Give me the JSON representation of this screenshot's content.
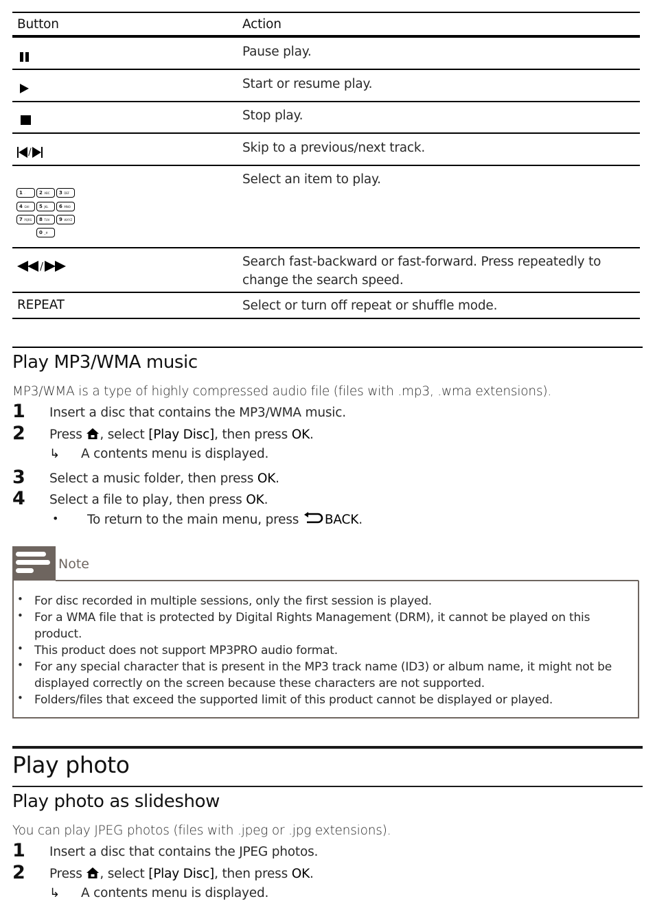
{
  "table": {
    "headers": {
      "button": "Button",
      "action": "Action"
    },
    "rows": [
      {
        "button_icon": "pause-icon",
        "button_text": "",
        "action": "Pause play."
      },
      {
        "button_icon": "play-icon",
        "button_text": "",
        "action": "Start or resume play."
      },
      {
        "button_icon": "stop-icon",
        "button_text": "",
        "action": "Stop play."
      },
      {
        "button_icon": "previous-next-icon",
        "button_text": "",
        "action": "Skip to a previous/next track."
      },
      {
        "button_icon": "numeric-keypad-icon",
        "button_text": "",
        "action": "Select an item to play."
      },
      {
        "button_icon": "fast-backward-forward-icon",
        "button_text": "",
        "action_line1": "Search fast-backward or fast-forward. Press repeatedly to",
        "action_line2": "change the search speed."
      },
      {
        "button_icon": "",
        "button_text": "REPEAT",
        "action": "Select or turn off repeat or shuffle mode."
      }
    ],
    "keypad": [
      {
        "num": "1",
        "sub": "."
      },
      {
        "num": "2",
        "sub": "ABC"
      },
      {
        "num": "3",
        "sub": "DEF"
      },
      {
        "num": "4",
        "sub": "GHI"
      },
      {
        "num": "5",
        "sub": "JKL"
      },
      {
        "num": "6",
        "sub": "MNO"
      },
      {
        "num": "7",
        "sub": "PQRS"
      },
      {
        "num": "8",
        "sub": "TUV"
      },
      {
        "num": "9",
        "sub": "WXYZ"
      },
      {
        "num": "0",
        "sub": "_#"
      }
    ],
    "skip_separator": "/",
    "search_separator": "/"
  },
  "mp3": {
    "title": "Play MP3/WMA music",
    "intro": "MP3/WMA is a type of highly compressed audio file (files with .mp3, .wma extensions).",
    "steps": [
      {
        "num": "1",
        "text": "Insert a disc that contains the MP3/WMA music."
      },
      {
        "num": "2",
        "pre": "Press ",
        "mid1": ", select ",
        "bold1": "[Play Disc]",
        "mid2": ", then press ",
        "bold2": "OK",
        "post": "."
      },
      {
        "num": "3",
        "pre": "Select a music folder, then press ",
        "bold": "OK",
        "post": "."
      },
      {
        "num": "4",
        "pre": "Select a file to play, then press ",
        "bold": "OK",
        "post": "."
      }
    ],
    "result": "A contents menu is displayed.",
    "bullet": {
      "pre": "To return to the main menu, press ",
      "bold": "BACK",
      "post": "."
    },
    "result_arrow": "↳",
    "bullet_mark": "•"
  },
  "note": {
    "title": "Note",
    "items": [
      "For disc recorded in multiple sessions, only the first session is played.",
      "For a WMA file that is protected by Digital Rights Management (DRM), it cannot be played on this",
      "product.",
      "This product does not support MP3PRO audio format.",
      "For any special character that is present in the MP3 track name (ID3) or album name, it might not be",
      "displayed correctly on the screen because these characters are not supported.",
      "Folders/files that exceed the supported limit of this product cannot be displayed or played."
    ],
    "bullet_mark": "•",
    "border_color": "#6e655f"
  },
  "photo": {
    "title": "Play photo",
    "subtitle": "Play photo as slideshow",
    "intro": "You can play JPEG photos (files with .jpeg or .jpg extensions).",
    "steps": [
      {
        "num": "1",
        "text": "Insert a disc that contains the JPEG photos."
      },
      {
        "num": "2",
        "pre": "Press ",
        "mid1": ", select ",
        "bold1": "[Play Disc]",
        "mid2": ", then press ",
        "bold2": "OK",
        "post": "."
      }
    ],
    "result": "A contents menu is displayed.",
    "result_arrow": "↳"
  }
}
